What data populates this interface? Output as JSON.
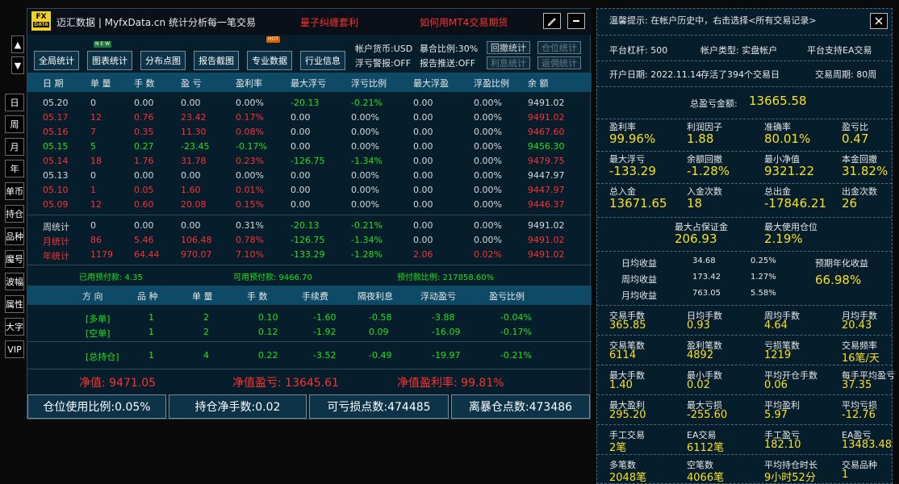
{
  "side": {
    "up": "▲",
    "down": "▼",
    "items": [
      "日",
      "周",
      "月",
      "年",
      "单币",
      "持仓",
      "品种",
      "魔号",
      "波幅",
      "属性",
      "大字",
      "VIP"
    ]
  },
  "titlebar": {
    "logo_top": "FX",
    "logo_bottom": "DATA",
    "title": "迈汇数据 | MyfxData.cn  统计分析每一笔交易",
    "promo1": "量子纠缠套利",
    "promo2": "如何用MT4交易期货",
    "edit_icon": "pencil-icon",
    "min_icon": "minimize-icon"
  },
  "toolbar": {
    "buttons": [
      "全局统计",
      "图表统计",
      "分布点图",
      "报告截图",
      "专业数据",
      "行业信息"
    ],
    "badge_new": "N E W",
    "badge_hot": "HOT",
    "currency": "帐户货币:USD",
    "ratio": "暴合比例:30%",
    "float_alert": "浮亏警报:OFF",
    "report_push": "报告推送:OFF",
    "small_buttons": [
      "回撤统计",
      "仓位统计",
      "利息统计",
      "返佣统计"
    ]
  },
  "daily": {
    "headers": [
      "日 期",
      "单 量",
      "手 数",
      "盈 亏",
      "盈利率",
      "最大浮亏",
      "浮亏比例",
      "最大浮盈",
      "浮盈比例",
      "余 额"
    ],
    "rows": [
      {
        "c": "w",
        "v": [
          "05.20",
          "0",
          "0.00",
          "0.00",
          "0.00%",
          "-20.13",
          "-0.21%",
          "0.00",
          "0.00%",
          "9491.02"
        ]
      },
      {
        "c": "rd",
        "v": [
          "05.17",
          "12",
          "0.76",
          "23.42",
          "0.17%",
          "0.00",
          "0.00%",
          "0.00",
          "0.00%",
          "9491.02"
        ]
      },
      {
        "c": "rd",
        "v": [
          "05.16",
          "7",
          "0.35",
          "11.30",
          "0.08%",
          "0.00",
          "0.00%",
          "0.00",
          "0.00%",
          "9467.60"
        ]
      },
      {
        "c": "g",
        "v": [
          "05.15",
          "5",
          "0.27",
          "-23.45",
          "-0.17%",
          "0.00",
          "0.00%",
          "0.00",
          "0.00%",
          "9456.30"
        ]
      },
      {
        "c": "rd",
        "v": [
          "05.14",
          "18",
          "1.76",
          "31.78",
          "0.23%",
          "-126.75",
          "-1.34%",
          "0.00",
          "0.00%",
          "9479.75"
        ]
      },
      {
        "c": "w",
        "v": [
          "05.13",
          "0",
          "0.00",
          "0.00",
          "0.00%",
          "0.00",
          "0.00%",
          "0.00",
          "0.00%",
          "9447.97"
        ]
      },
      {
        "c": "rd",
        "v": [
          "05.10",
          "1",
          "0.05",
          "1.60",
          "0.01%",
          "0.00",
          "0.00%",
          "0.00",
          "0.00%",
          "9447.97"
        ]
      },
      {
        "c": "rd",
        "v": [
          "05.09",
          "12",
          "0.60",
          "20.08",
          "0.15%",
          "0.00",
          "0.00%",
          "0.00",
          "0.00%",
          "9446.37"
        ]
      }
    ],
    "totals": [
      {
        "c": "w",
        "v": [
          "周统计",
          "0",
          "0.00",
          "0.00",
          "0.31%",
          "-20.13",
          "-0.21%",
          "0.00",
          "0.00%",
          "9491.02"
        ]
      },
      {
        "c": "rd",
        "v": [
          "月统计",
          "86",
          "5.46",
          "106.48",
          "0.78%",
          "-126.75",
          "-1.34%",
          "0.00",
          "0.00%",
          "9491.02"
        ]
      },
      {
        "c": "rd",
        "v": [
          "年统计",
          "1179",
          "64.44",
          "970.07",
          "7.10%",
          "-133.29",
          "-1.28%",
          "2.06",
          "0.02%",
          "9491.02"
        ]
      }
    ]
  },
  "prepay": {
    "used": "已用预付款: 4.35",
    "available": "可用预付款: 9466.70",
    "ratio": "预付款比例: 217858.60%"
  },
  "positions": {
    "headers": [
      "方 向",
      "品 种",
      "单 量",
      "手 数",
      "手续费",
      "隔夜利息",
      "浮动盈亏",
      "盈亏比例"
    ],
    "rows": [
      [
        "[多单]",
        "1",
        "2",
        "0.10",
        "-1.60",
        "-0.58",
        "-3.88",
        "-0.04%"
      ],
      [
        "[空单]",
        "1",
        "2",
        "0.12",
        "-1.92",
        "0.09",
        "-16.09",
        "-0.17%"
      ]
    ],
    "total": [
      "[总持仓]",
      "1",
      "4",
      "0.22",
      "-3.52",
      "-0.49",
      "-19.97",
      "-0.21%"
    ]
  },
  "net": {
    "value": "净值: 9471.05",
    "pl": "净值盈亏: 13645.61",
    "rate": "净值盈利率: 99.81%"
  },
  "bottom": [
    "仓位使用比例:0.05%",
    "持仓净手数:0.02",
    "可亏损点数:474485",
    "离暴仓点数:473486"
  ],
  "right": {
    "tip": "温馨提示: 在帐户历史中，右击选择<所有交易记录>",
    "close_icon": "close-icon",
    "leverage": "平台杠杆: 500",
    "acc_type": "帐户类型: 实盘帐户",
    "ea_support": "平台支持EA交易",
    "open_date": "开户日期: 2022.11.14",
    "days": "存活了394个交易日",
    "period": "交易周期: 80周",
    "total_pl_label": "总盈亏金额:",
    "total_pl_value": "13665.58",
    "grid1": [
      {
        "l": "盈利率",
        "v": "99.96%"
      },
      {
        "l": "利润因子",
        "v": "1.88"
      },
      {
        "l": "准确率",
        "v": "80.01%"
      },
      {
        "l": "盈亏比",
        "v": "0.47"
      },
      {
        "l": "最大浮亏",
        "v": "-133.29"
      },
      {
        "l": "余额回撤",
        "v": "-1.28%"
      },
      {
        "l": "最小净值",
        "v": "9321.22"
      },
      {
        "l": "本金回撤",
        "v": "31.82%"
      },
      {
        "l": "总入金",
        "v": "13671.65"
      },
      {
        "l": "入金次数",
        "v": "18"
      },
      {
        "l": "总出金",
        "v": "-17846.21"
      },
      {
        "l": "出金次数",
        "v": "26"
      }
    ],
    "margin_label": "最大占保证金",
    "margin_value": "206.93",
    "pos_label": "最大使用仓位",
    "pos_value": "2.19%",
    "avg": [
      {
        "l": "日均收益",
        "v": "34.68",
        "p": "0.25%"
      },
      {
        "l": "周均收益",
        "v": "173.42",
        "p": "1.27%"
      },
      {
        "l": "月均收益",
        "v": "763.05",
        "p": "5.58%"
      }
    ],
    "annual_label": "预期年化收益",
    "annual_value": "66.98%",
    "grid2": [
      {
        "l": "交易手数",
        "v": "365.85"
      },
      {
        "l": "日均手数",
        "v": "0.93"
      },
      {
        "l": "周均手数",
        "v": "4.64"
      },
      {
        "l": "月均手数",
        "v": "20.43"
      },
      {
        "l": "交易笔数",
        "v": "6114"
      },
      {
        "l": "盈利笔数",
        "v": "4892"
      },
      {
        "l": "亏损笔数",
        "v": "1219"
      },
      {
        "l": "交易频率",
        "v": "16笔/天"
      },
      {
        "l": "最大手数",
        "v": "1.40"
      },
      {
        "l": "最小手数",
        "v": "0.02"
      },
      {
        "l": "平均开仓手数",
        "v": "0.06"
      },
      {
        "l": "每手平均盈亏",
        "v": "37.35"
      },
      {
        "l": "最大盈利",
        "v": "295.20"
      },
      {
        "l": "最大亏损",
        "v": "-255.60"
      },
      {
        "l": "平均盈利",
        "v": "5.97"
      },
      {
        "l": "平均亏损",
        "v": "-12.76"
      },
      {
        "l": "手工交易",
        "v": "2笔"
      },
      {
        "l": "EA交易",
        "v": "6112笔"
      },
      {
        "l": "手工盈亏",
        "v": "182.10"
      },
      {
        "l": "EA盈亏",
        "v": "13483.48"
      },
      {
        "l": "多笔数",
        "v": "2048笔"
      },
      {
        "l": "空笔数",
        "v": "4066笔"
      },
      {
        "l": "平均持仓时长",
        "v": "9小时52分"
      },
      {
        "l": "交易品种",
        "v": "1"
      }
    ]
  }
}
